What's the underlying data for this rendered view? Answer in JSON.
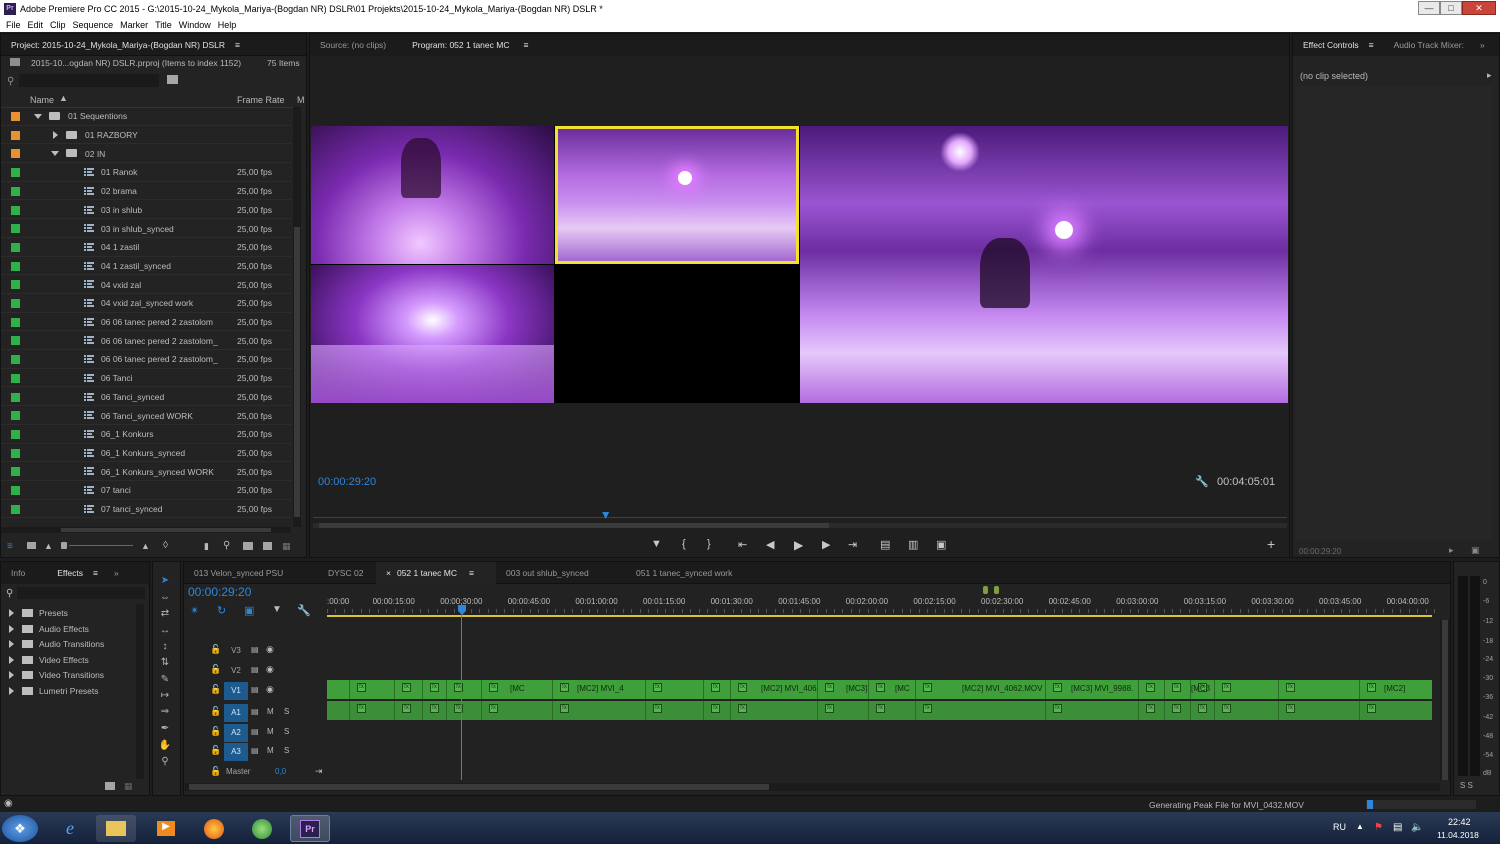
{
  "window": {
    "title": "Adobe Premiere Pro CC 2015 - G:\\2015-10-24_Mykola_Mariya-(Bogdan NR) DSLR\\01 Projekts\\2015-10-24_Mykola_Mariya-(Bogdan NR) DSLR *",
    "app_icon": "Pr"
  },
  "menu": [
    "File",
    "Edit",
    "Clip",
    "Sequence",
    "Marker",
    "Title",
    "Window",
    "Help"
  ],
  "project": {
    "tab_label": "Project: 2015-10-24_Mykola_Mariya-(Bogdan NR) DSLR",
    "file_line": "2015-10...ogdan NR) DSLR.prproj (Items to index 1152)",
    "item_count": "75 Items",
    "col_name": "Name",
    "col_fps": "Frame Rate",
    "col_m": "M",
    "items": [
      {
        "name": "01 Sequentions",
        "fps": "",
        "type": "folder",
        "color": "#e8912d",
        "indent": 0,
        "expand": "open"
      },
      {
        "name": "01 RAZBORY",
        "fps": "",
        "type": "folder",
        "color": "#e8912d",
        "indent": 1,
        "expand": "closed"
      },
      {
        "name": "02 IN",
        "fps": "",
        "type": "folder",
        "color": "#e8912d",
        "indent": 1,
        "expand": "open"
      },
      {
        "name": "01 Ranok",
        "fps": "25,00 fps",
        "type": "seq",
        "color": "#2fb04a"
      },
      {
        "name": "02 brama",
        "fps": "25,00 fps",
        "type": "seq",
        "color": "#2fb04a"
      },
      {
        "name": "03 in shlub",
        "fps": "25,00 fps",
        "type": "seq",
        "color": "#2fb04a"
      },
      {
        "name": "03 in shlub_synced",
        "fps": "25,00 fps",
        "type": "seq",
        "color": "#2fb04a"
      },
      {
        "name": "04 1 zastil",
        "fps": "25,00 fps",
        "type": "seq",
        "color": "#2fb04a"
      },
      {
        "name": "04 1 zastil_synced",
        "fps": "25,00 fps",
        "type": "seq",
        "color": "#2fb04a"
      },
      {
        "name": "04 vxid zal",
        "fps": "25,00 fps",
        "type": "seq",
        "color": "#2fb04a"
      },
      {
        "name": "04 vxid zal_synced work",
        "fps": "25,00 fps",
        "type": "seq",
        "color": "#2fb04a"
      },
      {
        "name": "06 06 tanec pered 2 zastolom",
        "fps": "25,00 fps",
        "type": "seq",
        "color": "#2fb04a"
      },
      {
        "name": "06 06 tanec pered 2 zastolom_",
        "fps": "25,00 fps",
        "type": "seq",
        "color": "#2fb04a"
      },
      {
        "name": "06 06 tanec pered 2 zastolom_",
        "fps": "25,00 fps",
        "type": "seq",
        "color": "#2fb04a"
      },
      {
        "name": "06 Tanci",
        "fps": "25,00 fps",
        "type": "seq",
        "color": "#2fb04a"
      },
      {
        "name": "06 Tanci_synced",
        "fps": "25,00 fps",
        "type": "seq",
        "color": "#2fb04a"
      },
      {
        "name": "06 Tanci_synced WORK",
        "fps": "25,00 fps",
        "type": "seq",
        "color": "#2fb04a"
      },
      {
        "name": "06_1 Konkurs",
        "fps": "25,00 fps",
        "type": "seq",
        "color": "#2fb04a"
      },
      {
        "name": "06_1 Konkurs_synced",
        "fps": "25,00 fps",
        "type": "seq",
        "color": "#2fb04a"
      },
      {
        "name": "06_1 Konkurs_synced WORK",
        "fps": "25,00 fps",
        "type": "seq",
        "color": "#2fb04a"
      },
      {
        "name": "07 tanci",
        "fps": "25,00 fps",
        "type": "seq",
        "color": "#2fb04a"
      },
      {
        "name": "07 tanci_synced",
        "fps": "25,00 fps",
        "type": "seq",
        "color": "#2fb04a"
      }
    ]
  },
  "monitor": {
    "source_tab": "Source: (no clips)",
    "program_tab": "Program: 052 1 tanec MC",
    "current_time": "00:00:29:20",
    "duration": "00:04:05:01",
    "playhead_fraction": 0.3
  },
  "effect_controls": {
    "tab": "Effect Controls",
    "tab2": "Audio Track Mixer:",
    "status": "(no clip selected)",
    "time": "00:00:29:20"
  },
  "effects": {
    "tab_info": "Info",
    "tab_effects": "Effects",
    "items": [
      "Presets",
      "Audio Effects",
      "Audio Transitions",
      "Video Effects",
      "Video Transitions",
      "Lumetri Presets"
    ]
  },
  "timeline": {
    "tabs": [
      "013 Velon_synced PSU",
      "DYSC 02",
      "052 1 tanec MC",
      "003 out shlub_synced",
      "051 1 tanec_synced work"
    ],
    "active_tab": "052 1 tanec MC",
    "timecode": "00:00:29:20",
    "ruler": [
      ":00:00",
      "00:00:15:00",
      "00:00:30:00",
      "00:00:45:00",
      "00:01:00:00",
      "00:01:15:00",
      "00:01:30:00",
      "00:01:45:00",
      "00:02:00:00",
      "00:02:15:00",
      "00:02:30:00",
      "00:02:45:00",
      "00:03:00:00",
      "00:03:15:00",
      "00:03:30:00",
      "00:03:45:00",
      "00:04:00:00"
    ],
    "video_tracks": [
      "V3",
      "V2",
      "V1"
    ],
    "audio_tracks": [
      "A1",
      "A2",
      "A3"
    ],
    "master_label": "Master",
    "master_value": "0,0",
    "clip_labels": [
      "[MC",
      "[MC2] MVI_4",
      "[MC2] MVI_406",
      "[MC3]",
      "[MC",
      "[MC2] MVI_4062.MOV",
      "[MC3] MVI_9988.",
      "[MC3",
      "[MC2]"
    ]
  },
  "meter_labels": [
    "0",
    "-6",
    "-12",
    "-18",
    "-24",
    "-30",
    "-36",
    "-42",
    "-48",
    "-54",
    "dB"
  ],
  "meter_ss": "S S",
  "status_bar": {
    "message": "Generating Peak File for MVI_0432.MOV"
  },
  "taskbar": {
    "lang": "RU",
    "time": "22:42",
    "date": "11.04.2018"
  }
}
